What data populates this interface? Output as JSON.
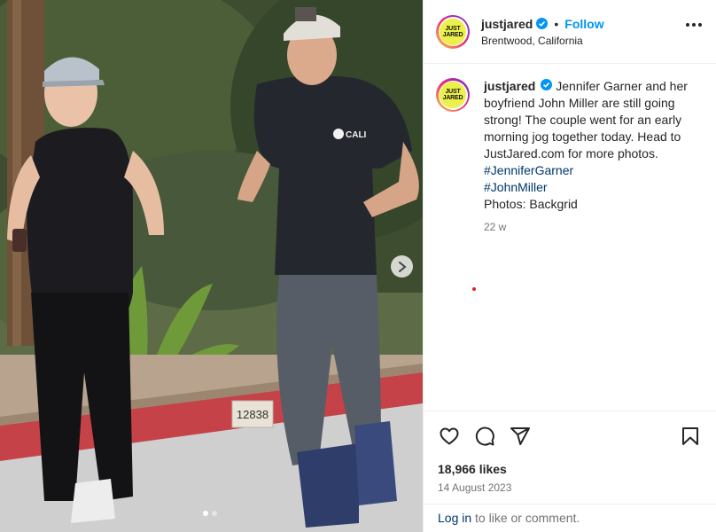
{
  "post": {
    "username": "justjared",
    "follow_label": "Follow",
    "bullet": "•",
    "location": "Brentwood, California",
    "avatar_text_line1": "JUST",
    "avatar_text_line2": "JARED",
    "caption_text": "Jennifer Garner and her boyfriend John Miller are still going strong! The couple went for an early morning jog together today. Head to JustJared.com for more photos.",
    "hashtags": [
      "#JenniferGarner",
      "#JohnMiller"
    ],
    "credit": "Photos: Backgrid",
    "age": "22 w",
    "likes": "18,966 likes",
    "date": "14 August 2023",
    "login_link": "Log in",
    "login_rest": " to like or comment."
  },
  "photo": {
    "shirt_logo": "CALI",
    "street_number": "12838",
    "carousel_count": 2,
    "carousel_active": 0
  },
  "icons": {
    "verified": "verified-badge-icon",
    "more": "more-options-icon",
    "like": "heart-icon",
    "comment": "comment-bubble-icon",
    "share": "paper-plane-icon",
    "save": "bookmark-icon",
    "next": "chevron-right-icon"
  },
  "colors": {
    "accent": "#0095f6",
    "link": "#00376b",
    "muted": "#737373",
    "avatar_yellow": "#ecf04a",
    "verified_blue": "#0095f6"
  }
}
